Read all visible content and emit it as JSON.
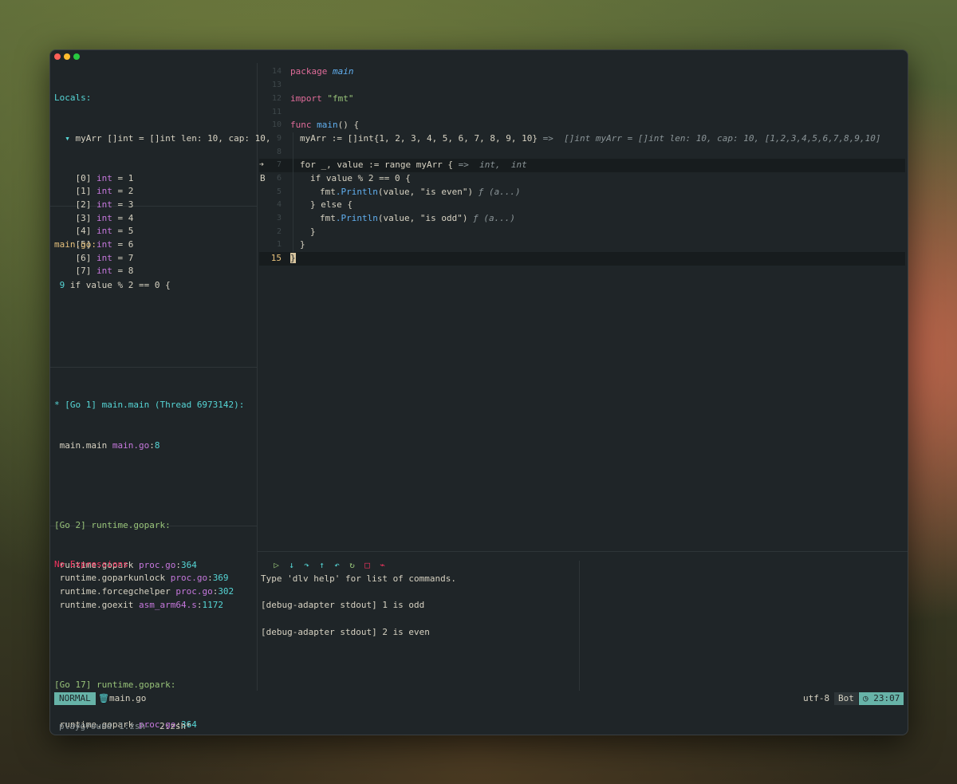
{
  "window": {
    "controls": [
      "close",
      "minimize",
      "zoom"
    ]
  },
  "locals": {
    "header": "Locals:",
    "root_label": "myArr []int = []int len: 10, cap: 10,",
    "items": [
      {
        "idx": "[0]",
        "type": "int",
        "val": "= 1"
      },
      {
        "idx": "[1]",
        "type": "int",
        "val": "= 2"
      },
      {
        "idx": "[2]",
        "type": "int",
        "val": "= 3"
      },
      {
        "idx": "[3]",
        "type": "int",
        "val": "= 4"
      },
      {
        "idx": "[4]",
        "type": "int",
        "val": "= 5"
      },
      {
        "idx": "[5]",
        "type": "int",
        "val": "= 6"
      },
      {
        "idx": "[6]",
        "type": "int",
        "val": "= 7"
      },
      {
        "idx": "[7]",
        "type": "int",
        "val": "= 8"
      }
    ]
  },
  "breakpoints": {
    "file": "main.go:",
    "entry_line": "9",
    "entry_text": "if value % 2 == 0 {"
  },
  "stacks": {
    "g1_prefix": "* ",
    "g1_header": "[Go 1] main.main (Thread 6973142):",
    "g1_frame_fn": "main.main",
    "g1_frame_file": "main.go",
    "g1_frame_line": "8",
    "g2_header": "[Go 2] runtime.gopark:",
    "g2_frames": [
      {
        "fn": "runtime.gopark",
        "file": "proc.go",
        "line": "364"
      },
      {
        "fn": "runtime.goparkunlock",
        "file": "proc.go",
        "line": "369"
      },
      {
        "fn": "runtime.forcegchelper",
        "file": "proc.go",
        "line": "302"
      },
      {
        "fn": "runtime.goexit",
        "file": "asm_arm64.s",
        "line": "1172"
      }
    ],
    "g17_header": "[Go 17] runtime.gopark:",
    "g17_frame_fn": "runtime.gopark",
    "g17_frame_file": "proc.go",
    "g17_frame_line": "364"
  },
  "watches": {
    "empty_text": "No Expressions"
  },
  "editor": {
    "line_numbers": [
      "14",
      "13",
      "12",
      "11",
      "10",
      "9",
      "8",
      "7",
      "6",
      "5",
      "4",
      "3",
      "2",
      "1",
      "15"
    ],
    "kw_package": "package",
    "pkg_name": "main",
    "kw_import": "import",
    "import_path": "\"fmt\"",
    "kw_func": "func",
    "fn_name": "main",
    "fn_sig": "() {",
    "l9_code": "myArr := []int{1, 2, 3, 4, 5, 6, 7, 8, 9, 10}",
    "l9_hint": " =>  []int myArr = []int len: 10, cap: 10, [1,2,3,4,5,6,7,8,9,10]",
    "l7_code": "for _, value := range myArr {",
    "l7_hint": " =>  int,  int",
    "l6_code": "if value % 2 == 0 {",
    "l5_pkg": "fmt",
    "l5_fn": ".Println",
    "l5_args": "(value, \"is even\")",
    "l5_hint": " ƒ (a...)",
    "l4_code": "} else {",
    "l3_pkg": "fmt",
    "l3_fn": ".Println",
    "l3_args": "(value, \"is odd\")",
    "l3_hint": " ƒ (a...)",
    "l2_code": "}",
    "l1_code": "}",
    "l15_code": "}",
    "sign_arrow": "➔",
    "sign_break": "B"
  },
  "dap_toolbar": {
    "icons": [
      {
        "name": "continue-icon",
        "glyph": "▷",
        "color": "#98c379"
      },
      {
        "name": "step-into-icon",
        "glyph": "↓",
        "color": "#56d6d6"
      },
      {
        "name": "step-over-icon",
        "glyph": "↷",
        "color": "#56d6d6"
      },
      {
        "name": "step-out-icon",
        "glyph": "↑",
        "color": "#56d6d6"
      },
      {
        "name": "step-back-icon",
        "glyph": "↶",
        "color": "#56d6d6"
      },
      {
        "name": "restart-icon",
        "glyph": "↻",
        "color": "#98c379"
      },
      {
        "name": "stop-icon",
        "glyph": "□",
        "color": "#f0345f"
      },
      {
        "name": "disconnect-icon",
        "glyph": "⌁",
        "color": "#f0345f"
      }
    ]
  },
  "repl": {
    "lines": [
      "Type 'dlv help' for list of commands.",
      "",
      "[debug-adapter stdout] 1 is odd",
      "",
      "[debug-adapter stdout] 2 is even"
    ]
  },
  "statusline": {
    "mode": "NORMAL",
    "file_icon": "🗑",
    "file": "main.go",
    "encoding": "utf-8",
    "position": "Bot",
    "clock_icon": "◷",
    "time": "23:07"
  },
  "tmux": {
    "session": "playground",
    "win1": "1:zsh-",
    "win2": "2:zsh*"
  },
  "colors": {
    "accent": "#67b3a8",
    "bg": "#1f2528",
    "cursor": "#d7c49e"
  }
}
